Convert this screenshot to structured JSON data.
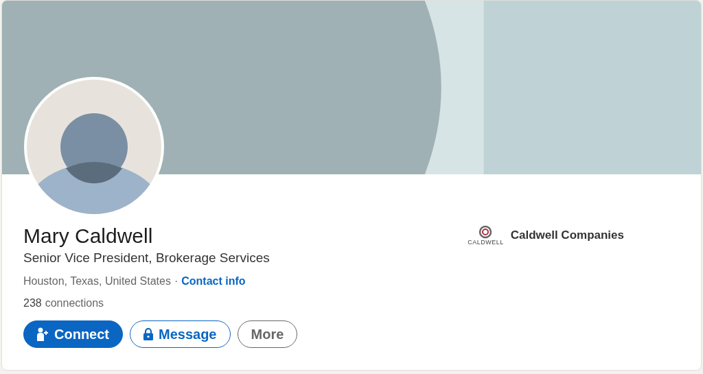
{
  "profile": {
    "name": "Mary Caldwell",
    "headline": "Senior Vice President, Brokerage Services",
    "location": "Houston, Texas, United States",
    "separator": "·",
    "contact_link": "Contact info",
    "connections_count": "238",
    "connections_label": "connections"
  },
  "company": {
    "logo_text": "CALDWELL",
    "name": "Caldwell Companies"
  },
  "actions": [
    {
      "kind": "connect",
      "label": "Connect"
    },
    {
      "kind": "message",
      "label": "Message"
    },
    {
      "kind": "more",
      "label": "More"
    }
  ]
}
